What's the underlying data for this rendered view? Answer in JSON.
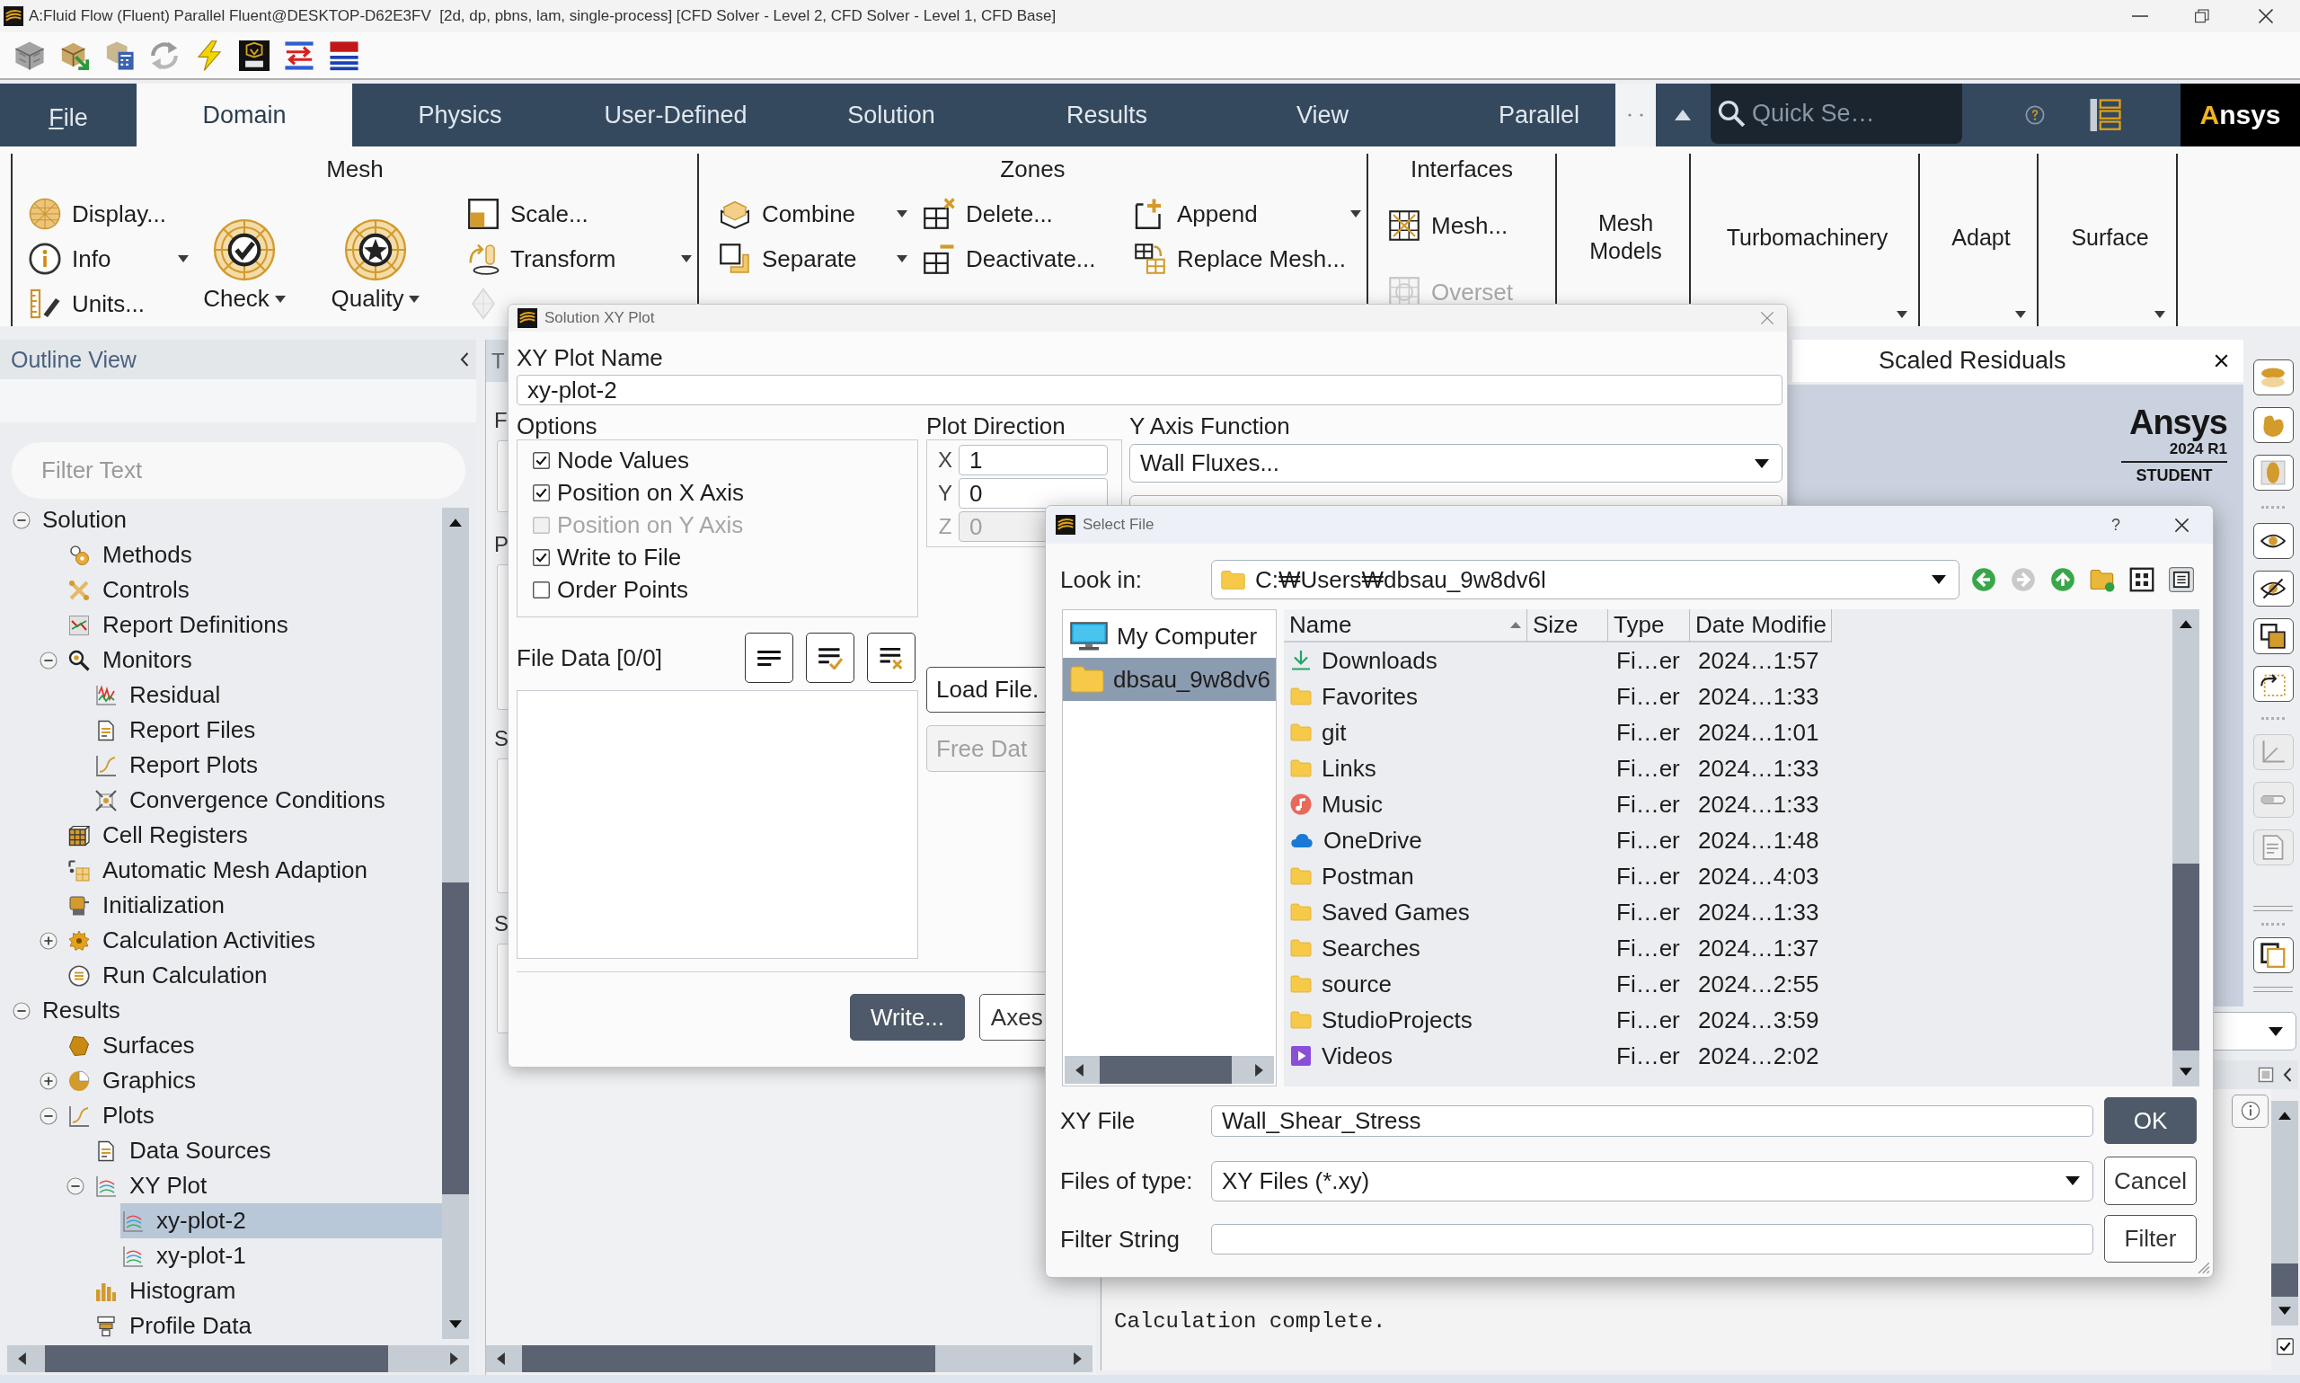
{
  "window": {
    "title": "A:Fluid Flow (Fluent) Parallel Fluent@DESKTOP-D62E3FV  [2d, dp, pbns, lam, single-process] [CFD Solver - Level 2, CFD Solver - Level 1, CFD Base]"
  },
  "ribbon": {
    "tabs": [
      {
        "label": "File",
        "kind": "menu",
        "selected": false
      },
      {
        "label": "Domain",
        "kind": "tab",
        "selected": true
      },
      {
        "label": "Physics",
        "kind": "tab",
        "selected": false
      },
      {
        "label": "User-Defined",
        "kind": "tab",
        "selected": false
      },
      {
        "label": "Solution",
        "kind": "tab",
        "selected": false
      },
      {
        "label": "Results",
        "kind": "tab",
        "selected": false
      },
      {
        "label": "View",
        "kind": "tab",
        "selected": false
      },
      {
        "label": "Parallel",
        "kind": "tab",
        "selected": false
      }
    ],
    "search": {
      "placeholder": "Quick Se…"
    },
    "logo": "Ansys",
    "groups": [
      {
        "title": "Mesh",
        "columns": [
          {
            "kind": "small",
            "items": [
              {
                "label": "Display...",
                "menu": false,
                "disabled": false
              },
              {
                "label": "Info",
                "menu": true,
                "disabled": false
              },
              {
                "label": "Units...",
                "menu": false,
                "disabled": false
              }
            ]
          },
          {
            "kind": "large",
            "items": [
              {
                "label": "Check",
                "menu": true,
                "disabled": false
              }
            ]
          },
          {
            "kind": "large",
            "items": [
              {
                "label": "Quality",
                "menu": true,
                "disabled": false
              }
            ]
          },
          {
            "kind": "small",
            "items": [
              {
                "label": "Scale...",
                "menu": false,
                "disabled": false
              },
              {
                "label": "Transform",
                "menu": true,
                "disabled": false
              },
              {
                "menu": false,
                "disabled": true
              }
            ]
          }
        ]
      },
      {
        "title": "Zones",
        "columns": [
          {
            "kind": "small",
            "items": [
              {
                "label": "Combine",
                "menu": true,
                "disabled": false
              },
              {
                "label": "Separate",
                "menu": true,
                "disabled": false
              }
            ]
          },
          {
            "kind": "small",
            "items": [
              {
                "label": "Delete...",
                "menu": false,
                "disabled": false
              },
              {
                "label": "Deactivate...",
                "menu": false,
                "disabled": false
              }
            ]
          },
          {
            "kind": "small",
            "items": [
              {
                "label": "Append",
                "menu": true,
                "disabled": false
              },
              {
                "label": "Replace Mesh...",
                "menu": false,
                "disabled": false
              }
            ]
          }
        ]
      },
      {
        "title": "Interfaces",
        "columns": [
          {
            "kind": "spaced",
            "items": [
              {
                "label": "Mesh...",
                "menu": false,
                "disabled": false
              },
              {
                "label": "Overset",
                "menu": false,
                "disabled": true
              }
            ]
          }
        ]
      },
      {
        "columns": [
          {
            "kind": "button",
            "items": [
              {
                "label": "Mesh Models",
                "menu": false,
                "disabled": false
              }
            ]
          }
        ]
      },
      {
        "columns": [
          {
            "kind": "button",
            "items": [
              {
                "label": "Turbomachinery",
                "menu": true,
                "disabled": false
              }
            ]
          }
        ]
      },
      {
        "columns": [
          {
            "kind": "button",
            "items": [
              {
                "label": "Adapt",
                "menu": true,
                "disabled": false
              }
            ]
          }
        ]
      },
      {
        "columns": [
          {
            "kind": "button",
            "items": [
              {
                "label": "Surface",
                "menu": true,
                "disabled": false
              }
            ]
          }
        ]
      }
    ]
  },
  "outline": {
    "title": "Outline View",
    "filter": {
      "placeholder": "Filter Text"
    },
    "tree": [
      {
        "label": "Solution",
        "expanded": true,
        "selected": false,
        "children": [
          {
            "label": "Methods",
            "selected": false
          },
          {
            "label": "Controls",
            "selected": false
          },
          {
            "label": "Report Definitions",
            "selected": false
          },
          {
            "label": "Monitors",
            "expanded": true,
            "selected": false,
            "children": [
              {
                "label": "Residual",
                "selected": false
              },
              {
                "label": "Report Files",
                "selected": false
              },
              {
                "label": "Report Plots",
                "selected": false
              },
              {
                "label": "Convergence Conditions",
                "selected": false
              }
            ]
          },
          {
            "label": "Cell Registers",
            "selected": false
          },
          {
            "label": "Automatic Mesh Adaption",
            "selected": false
          },
          {
            "label": "Initialization",
            "selected": false
          },
          {
            "label": "Calculation Activities",
            "expanded": false,
            "selected": false
          },
          {
            "label": "Run Calculation",
            "selected": false
          }
        ]
      },
      {
        "label": "Results",
        "expanded": true,
        "selected": false,
        "children": [
          {
            "label": "Surfaces",
            "selected": false
          },
          {
            "label": "Graphics",
            "expanded": false,
            "selected": false
          },
          {
            "label": "Plots",
            "expanded": true,
            "selected": false,
            "children": [
              {
                "label": "Data Sources",
                "selected": false
              },
              {
                "label": "XY Plot",
                "expanded": true,
                "selected": false,
                "children": [
                  {
                    "label": "xy-plot-2",
                    "selected": true
                  },
                  {
                    "label": "xy-plot-1",
                    "selected": false
                  }
                ]
              },
              {
                "label": "Histogram",
                "selected": false
              },
              {
                "label": "Profile Data",
                "selected": false
              }
            ]
          }
        ]
      }
    ]
  },
  "task_page": {
    "tab": "T",
    "labels": [
      "F",
      "P",
      "S",
      "S"
    ]
  },
  "graphics": {
    "tab": "Scaled Residuals",
    "watermark": {
      "brand": "Ansys",
      "release": "2024 R1",
      "edition": "STUDENT"
    }
  },
  "view_toolbar": {
    "tools": [
      {
        "disabled": false
      },
      {
        "disabled": false
      },
      {
        "disabled": false
      },
      {
        "disabled": false
      },
      {
        "disabled": false
      },
      {
        "disabled": false
      },
      {
        "disabled": false
      },
      {
        "disabled": true
      },
      {
        "disabled": true
      },
      {
        "disabled": true
      },
      {
        "disabled": false
      }
    ]
  },
  "console": {
    "text": "Calculation complete.",
    "checkbox": {
      "checked": true
    }
  },
  "xy_plot_dialog": {
    "title": "Solution XY Plot",
    "name_label": "XY Plot Name",
    "name_value": "xy-plot-2",
    "options_label": "Options",
    "options": [
      {
        "label": "Node Values",
        "checked": true,
        "disabled": false
      },
      {
        "label": "Position on X Axis",
        "checked": true,
        "disabled": false
      },
      {
        "label": "Position on Y Axis",
        "checked": false,
        "disabled": true
      },
      {
        "label": "Write to File",
        "checked": true,
        "disabled": false
      },
      {
        "label": "Order Points",
        "checked": false,
        "disabled": false
      }
    ],
    "direction_label": "Plot Direction",
    "direction": [
      {
        "axis": "X",
        "value": "1",
        "disabled": false
      },
      {
        "axis": "Y",
        "value": "0",
        "disabled": false
      },
      {
        "axis": "Z",
        "value": "0",
        "disabled": true
      }
    ],
    "y_axis_label": "Y Axis Function",
    "y_axis_value": "Wall Fluxes...",
    "file_data_label": "File Data [0/0]",
    "side_buttons": [
      {
        "label": "Load File.",
        "disabled": false
      },
      {
        "label": "Free Dat",
        "disabled": true
      }
    ],
    "buttons": [
      {
        "label": "Write...",
        "kind": "primary"
      },
      {
        "label": "Axes",
        "kind": "normal"
      }
    ]
  },
  "select_file_dialog": {
    "title": "Select File",
    "help": "?",
    "look_in_label": "Look in:",
    "look_in_value": "C:₩Users₩dbsau_9w8dv6l",
    "places": [
      {
        "label": "My Computer",
        "selected": false
      },
      {
        "label": "dbsau_9w8dv6",
        "selected": true
      }
    ],
    "columns": [
      {
        "label": "Name",
        "sorted": true
      },
      {
        "label": "Size",
        "sorted": false
      },
      {
        "label": "Type",
        "sorted": false
      },
      {
        "label": "Date Modifie",
        "sorted": false
      }
    ],
    "files": [
      {
        "name": "Downloads",
        "type": "Fi…er",
        "date": "2024…1:57",
        "selected": false
      },
      {
        "name": "Favorites",
        "type": "Fi…er",
        "date": "2024…1:33",
        "selected": false
      },
      {
        "name": "git",
        "type": "Fi…er",
        "date": "2024…1:01",
        "selected": false
      },
      {
        "name": "Links",
        "type": "Fi…er",
        "date": "2024…1:33",
        "selected": false
      },
      {
        "name": "Music",
        "type": "Fi…er",
        "date": "2024…1:33",
        "selected": false
      },
      {
        "name": "OneDrive",
        "type": "Fi…er",
        "date": "2024…1:48",
        "selected": false
      },
      {
        "name": "Postman",
        "type": "Fi…er",
        "date": "2024…4:03",
        "selected": false
      },
      {
        "name": "Saved Games",
        "type": "Fi…er",
        "date": "2024…1:33",
        "selected": false
      },
      {
        "name": "Searches",
        "type": "Fi…er",
        "date": "2024…1:37",
        "selected": false
      },
      {
        "name": "source",
        "type": "Fi…er",
        "date": "2024…2:55",
        "selected": false
      },
      {
        "name": "StudioProjects",
        "type": "Fi…er",
        "date": "2024…3:59",
        "selected": false
      },
      {
        "name": "Videos",
        "type": "Fi…er",
        "date": "2024…2:02",
        "selected": false
      }
    ],
    "xy_file_label": "XY File",
    "xy_file_value": "Wall_Shear_Stress",
    "type_label": "Files of type:",
    "type_value": "XY Files (*.xy)",
    "filter_label": "Filter String",
    "buttons": [
      {
        "label": "OK",
        "kind": "primary"
      },
      {
        "label": "Cancel",
        "kind": "normal"
      },
      {
        "label": "Filter",
        "kind": "normal"
      }
    ]
  }
}
